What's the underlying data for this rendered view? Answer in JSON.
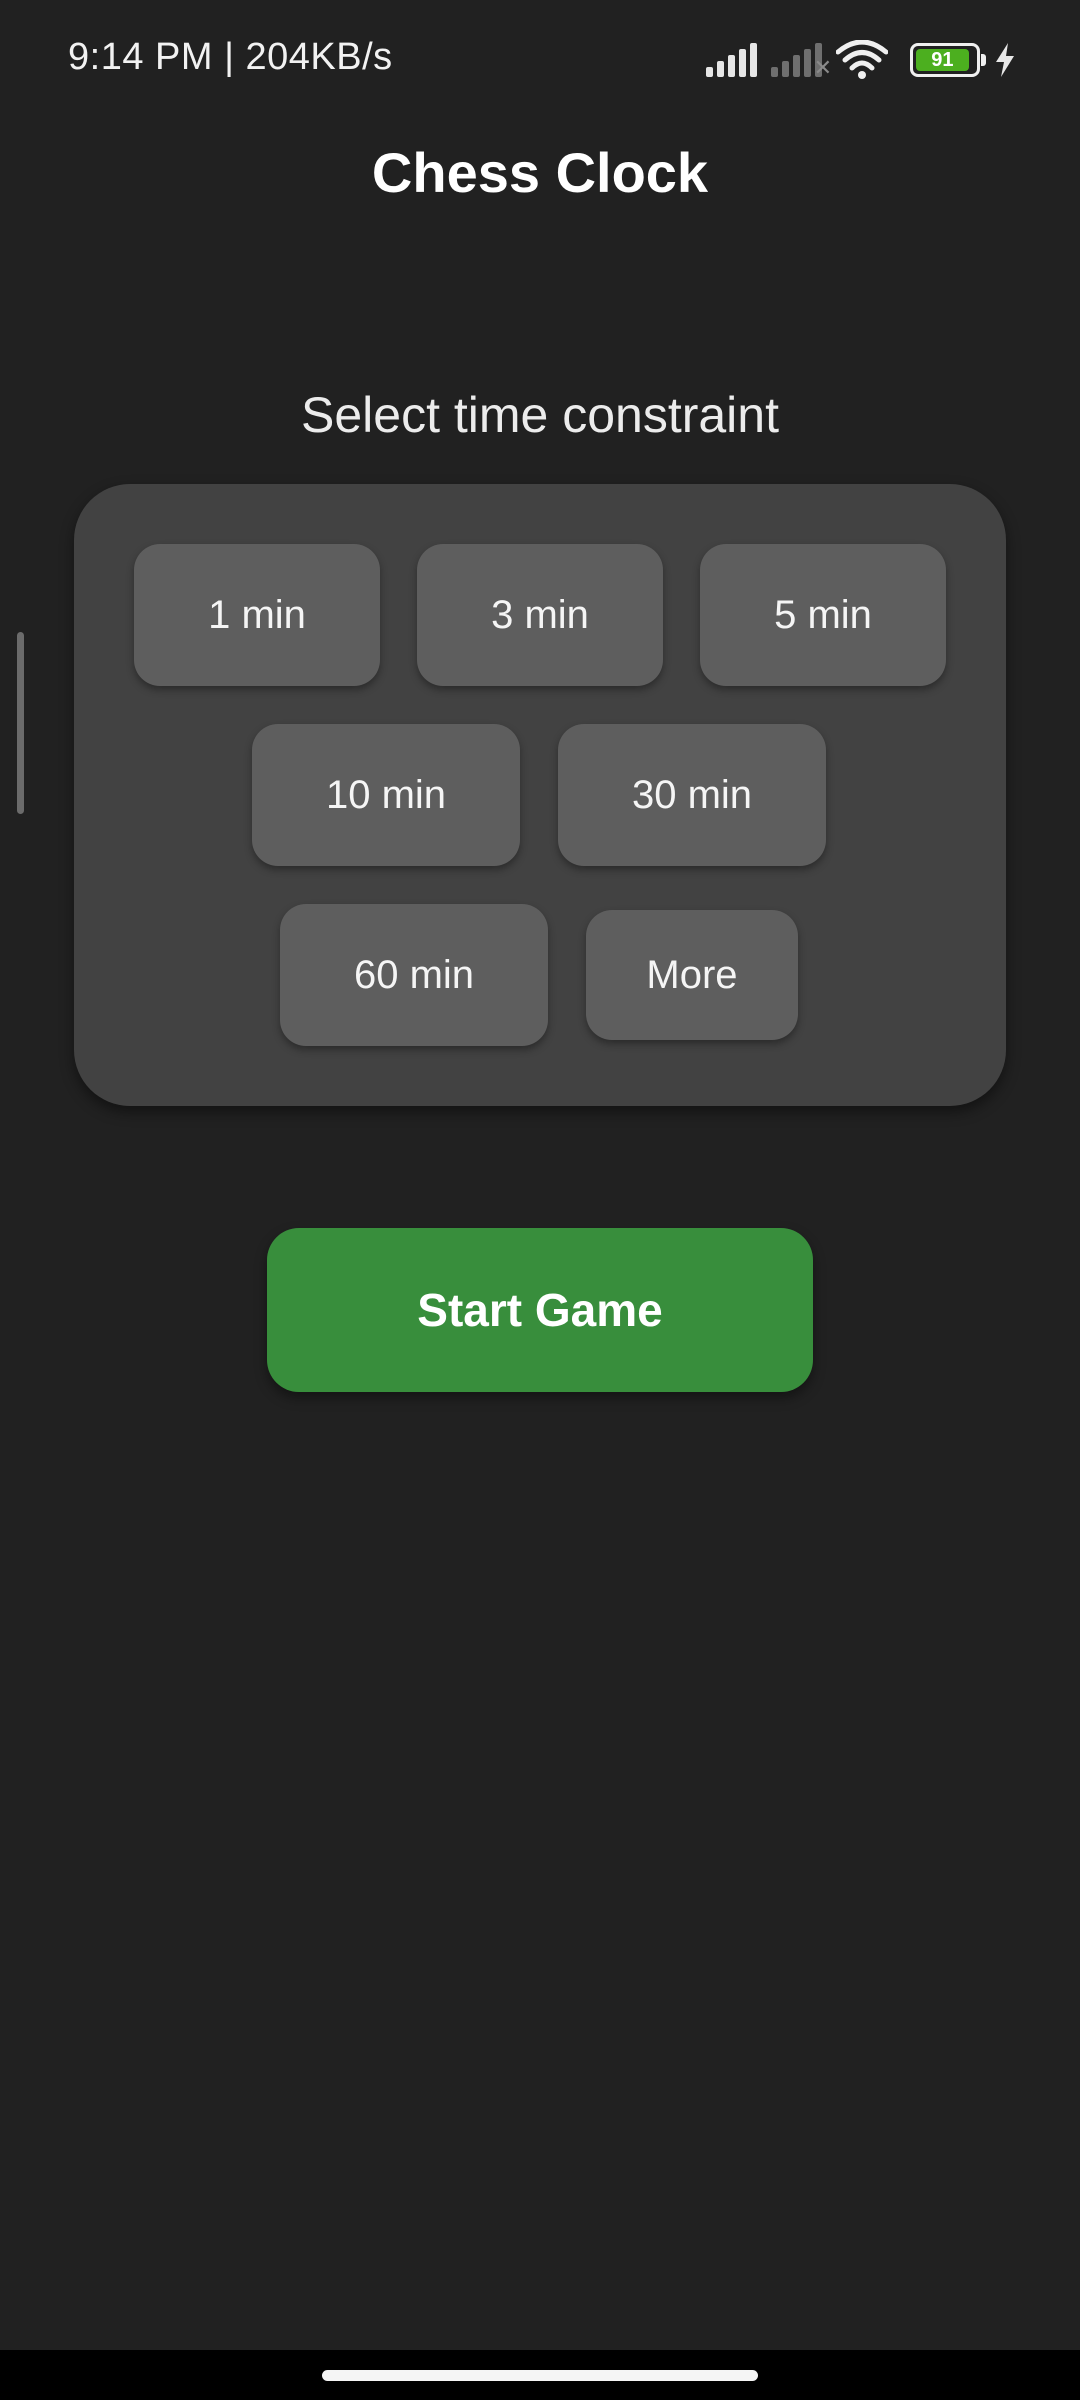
{
  "status_bar": {
    "time_and_speed": "9:14 PM | 204KB/s",
    "battery_level": "91",
    "battery_fraction": 0.91,
    "charging": true
  },
  "app": {
    "title": "Chess Clock"
  },
  "time_select": {
    "label": "Select time constraint",
    "options": [
      "1 min",
      "3 min",
      "5 min",
      "10 min",
      "30 min",
      "60 min",
      "More"
    ]
  },
  "actions": {
    "start_label": "Start Game"
  },
  "colors": {
    "background": "#212121",
    "panel": "#424242",
    "option_button": "#5e5e5e",
    "start_button": "#388e3c",
    "battery_fill": "#4caf1f"
  },
  "icons": {
    "signal_1": "signal-bars-icon",
    "signal_2": "signal-bars-no-service-icon",
    "wifi": "wifi-icon",
    "battery": "battery-icon",
    "charging": "lightning-bolt-icon"
  }
}
